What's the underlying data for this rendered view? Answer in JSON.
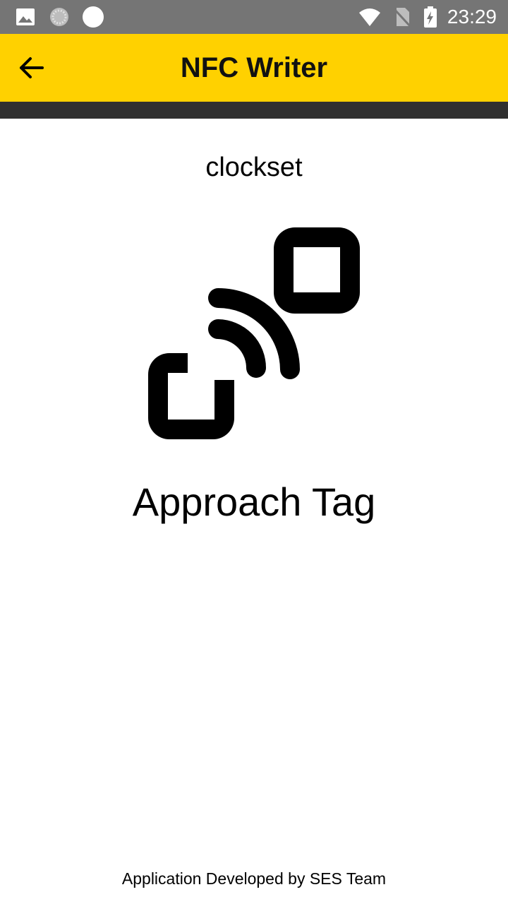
{
  "status_bar": {
    "time": "23:29",
    "icons": [
      "image-icon",
      "sync-icon",
      "circle-icon",
      "wifi-icon",
      "no-sim-icon",
      "battery-charging-icon"
    ],
    "background": "#757575"
  },
  "app_bar": {
    "back_icon": "arrow-back-icon",
    "title": "NFC Writer",
    "background": "#ffd100"
  },
  "main": {
    "tag_name": "clockset",
    "graphic_icon": "nfc-tap-icon",
    "instruction": "Approach Tag"
  },
  "footer": {
    "text": "Application Developed by SES Team"
  }
}
